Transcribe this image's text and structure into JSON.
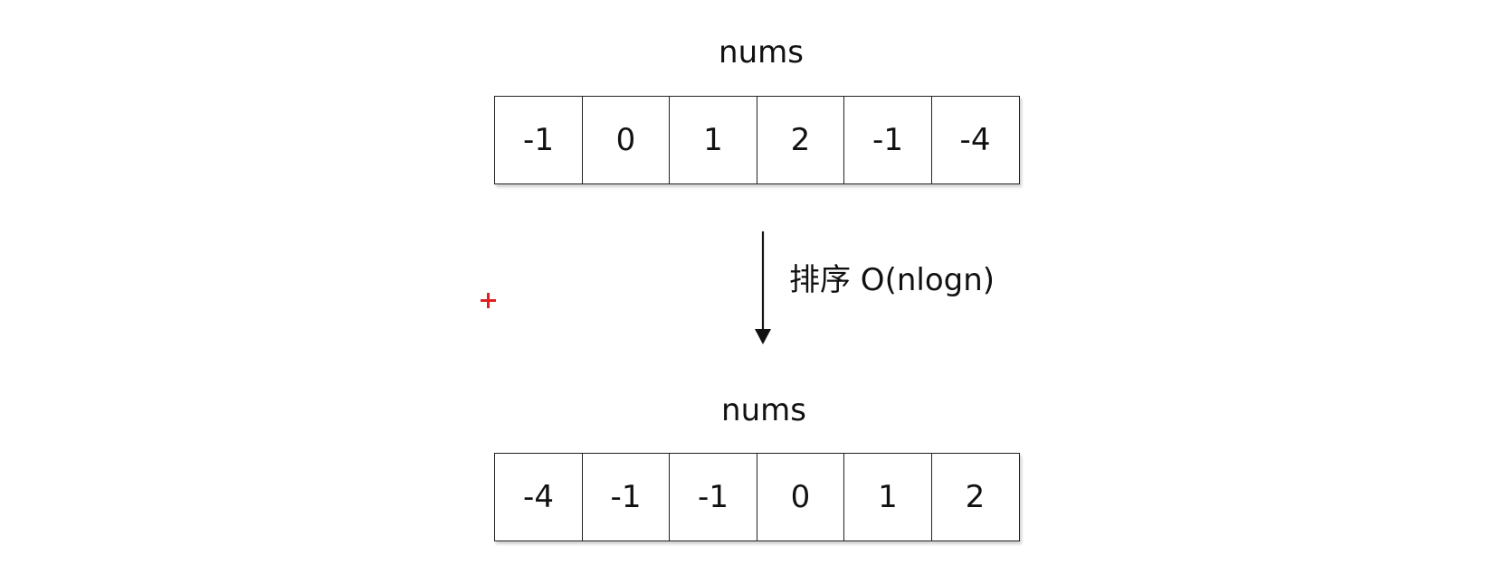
{
  "diagram": {
    "top_array": {
      "label": "nums",
      "values": [
        "-1",
        "0",
        "1",
        "2",
        "-1",
        "-4"
      ]
    },
    "transition": {
      "caption": "排序 O(nlogn)"
    },
    "bottom_array": {
      "label": "nums",
      "values": [
        "-4",
        "-1",
        "-1",
        "0",
        "1",
        "2"
      ]
    },
    "colors": {
      "stroke": "#222222",
      "marker": "#e02020"
    }
  }
}
